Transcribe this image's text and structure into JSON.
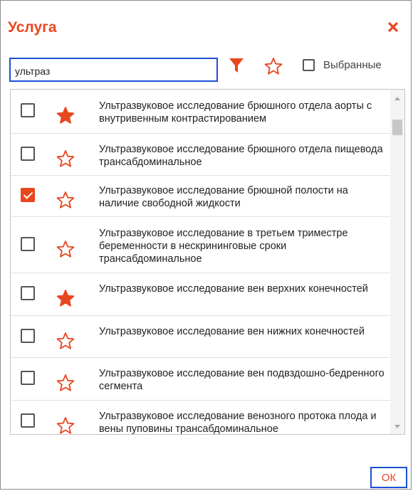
{
  "dialog": {
    "title": "Услуга",
    "search": {
      "value": "ультраз",
      "placeholder": ""
    },
    "favorites_label": "Выбранные",
    "ok_label": "ОК"
  },
  "colors": {
    "accent": "#e8461f",
    "focus_border": "#1b4fd6"
  },
  "icons": {
    "close": "close-icon",
    "filter": "filter-icon",
    "star": "star-icon",
    "star_filled": "star-filled-icon"
  },
  "services": [
    {
      "label": "Ультразвуковое исследование брюшного отдела аорты с внутривенным контрастированием",
      "checked": false,
      "favorite": true
    },
    {
      "label": "Ультразвуковое исследование брюшного отдела пищевода трансабдоминальное",
      "checked": false,
      "favorite": false
    },
    {
      "label": "Ультразвуковое исследование брюшной полости на наличие свободной жидкости",
      "checked": true,
      "favorite": false
    },
    {
      "label": "Ультразвуковое исследование в третьем триместре беременности в нескрининговые сроки трансабдоминальное",
      "checked": false,
      "favorite": false
    },
    {
      "label": "Ультразвуковое исследование вен верхних конечностей",
      "checked": false,
      "favorite": true
    },
    {
      "label": "Ультразвуковое исследование вен нижних конечностей",
      "checked": false,
      "favorite": false
    },
    {
      "label": "Ультразвуковое исследование вен подвздошно-бедренного сегмента",
      "checked": false,
      "favorite": false
    },
    {
      "label": "Ультразвуковое исследование венозного протока плода и вены пуповины трансабдоминальное",
      "checked": false,
      "favorite": false
    }
  ]
}
